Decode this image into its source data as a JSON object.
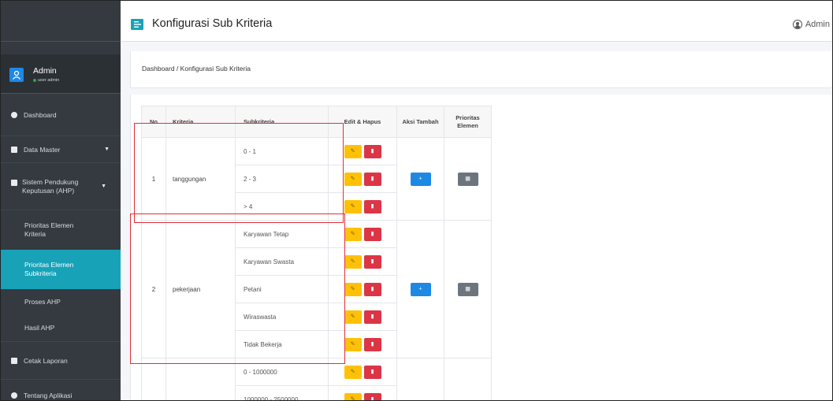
{
  "sidebar": {
    "user": {
      "name": "Admin",
      "role": "user admin"
    },
    "items": [
      {
        "label": "Dashboard",
        "icon": "dashboard-icon"
      },
      {
        "label": "Data Master",
        "icon": "database-icon"
      },
      {
        "label": "Sistem Pendukung Keputusan (AHP)",
        "icon": "book-icon"
      },
      {
        "label": "Cetak Laporan",
        "icon": "print-icon"
      },
      {
        "label": "Tentang Aplikasi",
        "icon": "info-icon"
      }
    ],
    "subitems": [
      {
        "label": "Prioritas Elemen Kriteria"
      },
      {
        "label": "Prioritas Elemen Subkriteria"
      },
      {
        "label": "Proses AHP"
      },
      {
        "label": "Hasil AHP"
      }
    ]
  },
  "navbar": {
    "title": "Konfigurasi Sub Kriteria",
    "user": "Admin"
  },
  "breadcrumb": "Dashboard / Konfigurasi Sub Kriteria",
  "table": {
    "headers": {
      "no": "No",
      "kriteria": "Kriteria",
      "subkriteria": "Subkriteria",
      "edit_hapus": "Edit & Hapus",
      "aksi_tambah": "Aksi Tambah",
      "prioritas": "Prioritas Elemen"
    },
    "groups": [
      {
        "no": "1",
        "kriteria": "tanggungan",
        "subs": [
          "0 - 1",
          "2 - 3",
          "> 4"
        ]
      },
      {
        "no": "2",
        "kriteria": "pekerjaan",
        "subs": [
          "Karyawan Tetap",
          "Karyawan Swasta",
          "Petani",
          "Wiraswasta",
          "Tidak Bekerja"
        ]
      },
      {
        "no": "",
        "kriteria": "",
        "subs": [
          "0 - 1000000",
          "1000000 - 2500000"
        ]
      }
    ]
  },
  "colors": {
    "sidebar_bg": "#343a40",
    "active": "#17a2b8",
    "warning": "#ffc107",
    "danger": "#dc3545",
    "primary": "#1e88e5",
    "secondary": "#6c757d",
    "annotation": "#e0303a"
  }
}
